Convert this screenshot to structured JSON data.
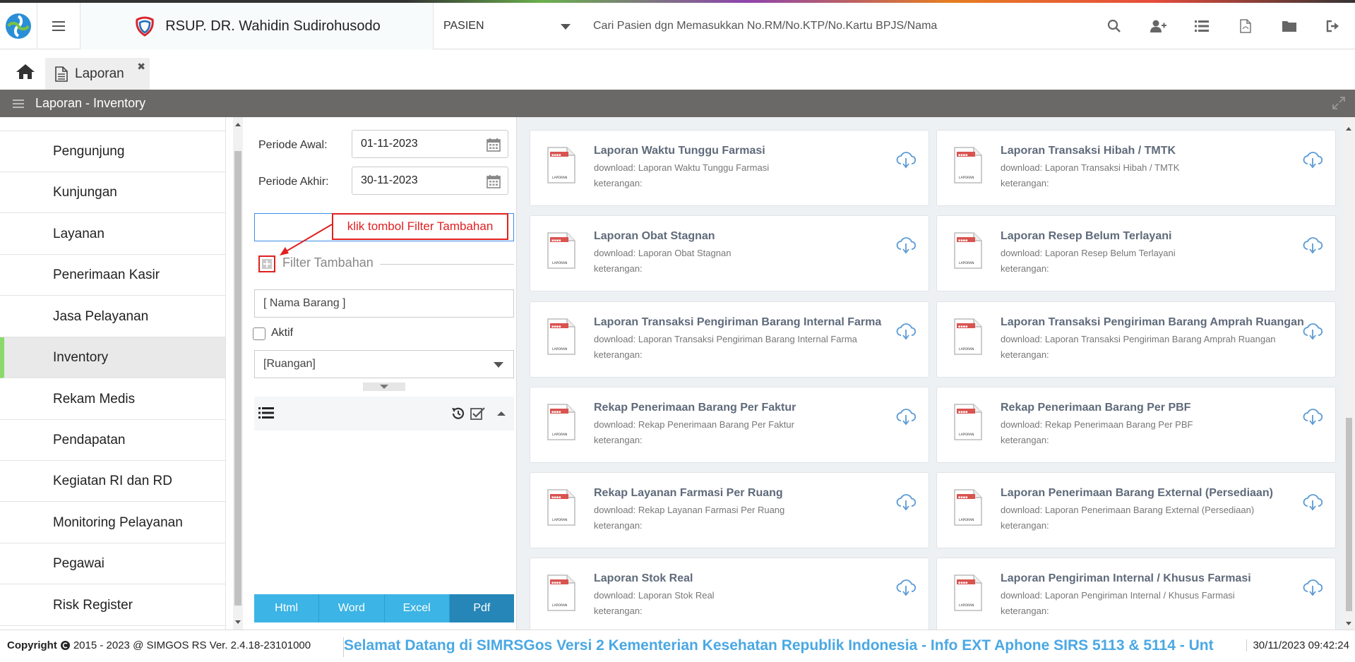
{
  "header": {
    "hospital_name": "RSUP. DR. Wahidin Sudirohusodo",
    "patient_select": "PASIEN",
    "search_placeholder": "Cari Pasien dgn Memasukkan No.RM/No.KTP/No.Kartu BPJS/Nama"
  },
  "tabs": [
    {
      "label": "Laporan"
    }
  ],
  "titlebar": {
    "title": "Laporan - Inventory"
  },
  "sidebar": {
    "items": [
      {
        "label": "Pengunjung"
      },
      {
        "label": "Kunjungan"
      },
      {
        "label": "Layanan"
      },
      {
        "label": "Penerimaan Kasir"
      },
      {
        "label": "Jasa Pelayanan"
      },
      {
        "label": "Inventory",
        "active": true
      },
      {
        "label": "Rekam Medis"
      },
      {
        "label": "Pendapatan"
      },
      {
        "label": "Kegiatan RI dan RD"
      },
      {
        "label": "Monitoring Pelayanan"
      },
      {
        "label": "Pegawai"
      },
      {
        "label": "Risk Register"
      }
    ]
  },
  "filter": {
    "periode_awal_label": "Periode Awal:",
    "periode_awal_value": "01-11-2023",
    "periode_akhir_label": "Periode Akhir:",
    "periode_akhir_value": "30-11-2023",
    "callout": "klik tombol Filter Tambahan",
    "filter_tambahan_label": "Filter Tambahan",
    "nama_barang_placeholder": "[ Nama Barang ]",
    "aktif_label": "Aktif",
    "ruangan_value": "[Ruangan]",
    "buttons": [
      "Html",
      "Word",
      "Excel",
      "Pdf"
    ]
  },
  "reports": [
    {
      "title": "Laporan Waktu Tunggu Farmasi",
      "download": "download: Laporan Waktu Tunggu Farmasi",
      "keterangan": "keterangan:"
    },
    {
      "title": "Laporan Transaksi Hibah / TMTK",
      "download": "download: Laporan Transaksi Hibah / TMTK",
      "keterangan": "keterangan:"
    },
    {
      "title": "Laporan Obat Stagnan",
      "download": "download: Laporan Obat Stagnan",
      "keterangan": "keterangan:"
    },
    {
      "title": "Laporan Resep Belum Terlayani",
      "download": "download: Laporan Resep Belum Terlayani",
      "keterangan": "keterangan:"
    },
    {
      "title": "Laporan Transaksi Pengiriman Barang Internal Farma",
      "download": "download: Laporan Transaksi Pengiriman Barang Internal Farma",
      "keterangan": "keterangan:"
    },
    {
      "title": "Laporan Transaksi Pengiriman Barang Amprah Ruangan",
      "download": "download: Laporan Transaksi Pengiriman Barang Amprah Ruangan",
      "keterangan": "keterangan:"
    },
    {
      "title": "Rekap Penerimaan Barang Per Faktur",
      "download": "download: Rekap Penerimaan Barang Per Faktur",
      "keterangan": "keterangan:"
    },
    {
      "title": "Rekap Penerimaan Barang Per PBF",
      "download": "download: Rekap Penerimaan Barang Per PBF",
      "keterangan": "keterangan:"
    },
    {
      "title": "Rekap Layanan Farmasi Per Ruang",
      "download": "download: Rekap Layanan Farmasi Per Ruang",
      "keterangan": "keterangan:"
    },
    {
      "title": "Laporan Penerimaan Barang External (Persediaan)",
      "download": "download: Laporan Penerimaan Barang External (Persediaan)",
      "keterangan": "keterangan:"
    },
    {
      "title": "Laporan Stok Real",
      "download": "download: Laporan Stok Real",
      "keterangan": "keterangan:"
    },
    {
      "title": "Laporan Pengiriman Internal / Khusus Farmasi",
      "download": "download: Laporan Pengiriman Internal / Khusus Farmasi",
      "keterangan": "keterangan:"
    }
  ],
  "footer": {
    "copyright_label": "Copyright",
    "copyright_text": "2015 - 2023 @ SIMGOS RS Ver. 2.4.18-23101000",
    "marquee": "Selamat Datang di SIMRSGos Versi 2 Kementerian Kesehatan Republik Indonesia - Info EXT Aphone SIRS 5113 & 5114 - Unt",
    "datetime": "30/11/2023 09:42:24"
  },
  "colors": {
    "accent": "#3cb4e5",
    "active_marker": "#8cd96b",
    "callout": "#e02020",
    "titlebar": "#6b6868"
  }
}
